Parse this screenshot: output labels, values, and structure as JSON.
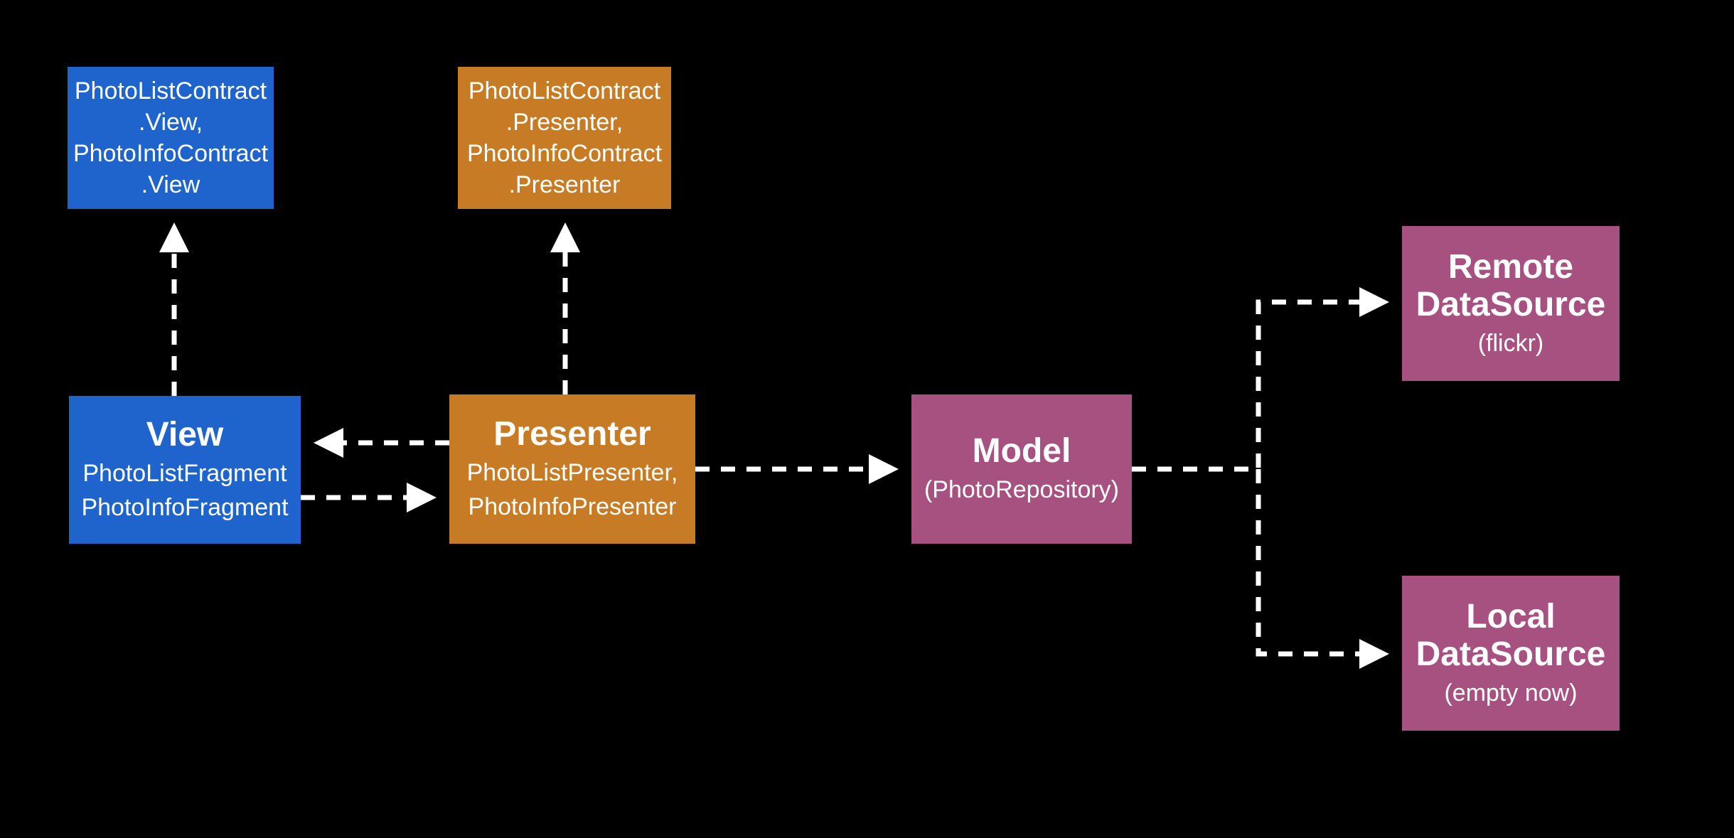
{
  "boxes": {
    "view_contract": {
      "line1": "PhotoListContract",
      "line2": ".View,",
      "line3": "PhotoInfoContract",
      "line4": ".View"
    },
    "presenter_contract": {
      "line1": "PhotoListContract",
      "line2": ".Presenter,",
      "line3": "PhotoInfoContract",
      "line4": ".Presenter"
    },
    "view": {
      "title": "View",
      "sub1": "PhotoListFragment",
      "sub2": "PhotoInfoFragment"
    },
    "presenter": {
      "title": "Presenter",
      "sub1": "PhotoListPresenter,",
      "sub2": "PhotoInfoPresenter"
    },
    "model": {
      "title": "Model",
      "sub1": "(PhotoRepository)"
    },
    "remote": {
      "title1": "Remote",
      "title2": "DataSource",
      "sub1": "(flickr)"
    },
    "local": {
      "title1": "Local",
      "title2": "DataSource",
      "sub1": "(empty now)"
    }
  },
  "colors": {
    "view": "#1f63cc",
    "presenter": "#c67b24",
    "model": "#a75181",
    "arrow": "#ffffff"
  }
}
